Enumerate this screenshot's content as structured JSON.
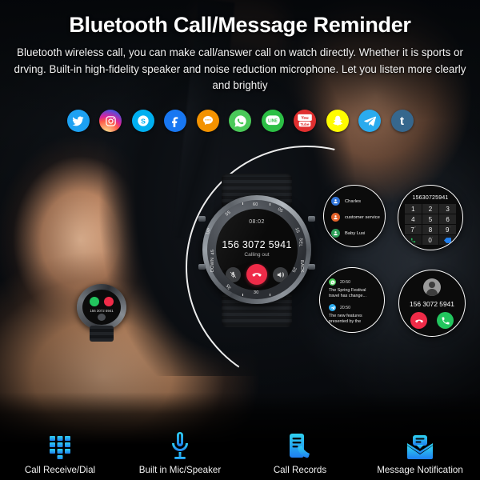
{
  "header": {
    "title": "Bluetooth Call/Message Reminder",
    "subtitle": "Bluetooth wireless call, you can  make call/answer call on watch directly. Whether it is sports or drving. Built-in high-fidelity speaker and noise reduction microphone. Let you listen more clearly and brightiy"
  },
  "social_icons": [
    {
      "name": "twitter-icon",
      "color": "#1da1f2"
    },
    {
      "name": "instagram-icon",
      "color": "#c13584"
    },
    {
      "name": "skype-icon",
      "color": "#00aff0"
    },
    {
      "name": "facebook-icon",
      "color": "#1877f2"
    },
    {
      "name": "messages-icon",
      "color": "#f39200"
    },
    {
      "name": "whatsapp-icon",
      "color": "#4ac959"
    },
    {
      "name": "line-icon",
      "color": "#2cbf45"
    },
    {
      "name": "youtube-icon",
      "color": "#e02f2f",
      "label": "You"
    },
    {
      "name": "snapchat-icon",
      "color": "#fffc00"
    },
    {
      "name": "telegram-icon",
      "color": "#2aabee"
    },
    {
      "name": "tumblr-icon",
      "color": "#36678d",
      "label": "t"
    }
  ],
  "watch": {
    "time": "08:02",
    "number": "156 3072 5941",
    "state": "Calling out",
    "bezel_labels": [
      "60",
      "05",
      "15",
      "25",
      "30",
      "35",
      "45",
      "55",
      "UP",
      "SEL",
      "DOWN",
      "BACK"
    ],
    "controls": [
      {
        "name": "mute-button",
        "icon": "mic-muted-icon"
      },
      {
        "name": "end-call-button",
        "icon": "phone-hangup-icon",
        "color": "#ef2b48"
      },
      {
        "name": "speaker-button",
        "icon": "speaker-icon"
      }
    ]
  },
  "contacts": {
    "items": [
      {
        "name": "Charles",
        "color": "#2f73d8"
      },
      {
        "name": "customer service",
        "color": "#e2622a"
      },
      {
        "name": "Baby Lusi",
        "color": "#2fa05a"
      }
    ]
  },
  "dialpad": {
    "number": "15630725941",
    "keys": [
      "1",
      "2",
      "3",
      "4",
      "5",
      "6",
      "7",
      "8",
      "9"
    ],
    "key_sups": [
      "",
      "",
      "",
      "",
      "",
      "",
      "\"",
      "",
      "'"
    ],
    "zero": "0",
    "zero_sup": "'",
    "call_key": "call-icon",
    "backspace_key": "backspace-icon"
  },
  "messages": {
    "items": [
      {
        "app": "whatsapp-icon",
        "color": "#4ac959",
        "time": "20:50",
        "text": "The Spring Festival travel has change..."
      },
      {
        "app": "telegram-icon",
        "color": "#2aabee",
        "time": "20:50",
        "text": "The new features presented by the"
      }
    ]
  },
  "incoming_call": {
    "number": "156 3072 5941",
    "decline_label": "decline-call-button",
    "accept_label": "accept-call-button"
  },
  "features": [
    {
      "icon": "dialpad-icon",
      "label": "Call Receive/Dial"
    },
    {
      "icon": "microphone-icon",
      "label": "Built in Mic/Speaker"
    },
    {
      "icon": "call-records-icon",
      "label": "Call Records"
    },
    {
      "icon": "message-envelope-icon",
      "label": "Message Notification"
    }
  ],
  "colors": {
    "accent_cyan": "#29c6f2",
    "accent_blue": "#1f7ff0",
    "call_green": "#22c55e",
    "end_red": "#ef2b48"
  }
}
